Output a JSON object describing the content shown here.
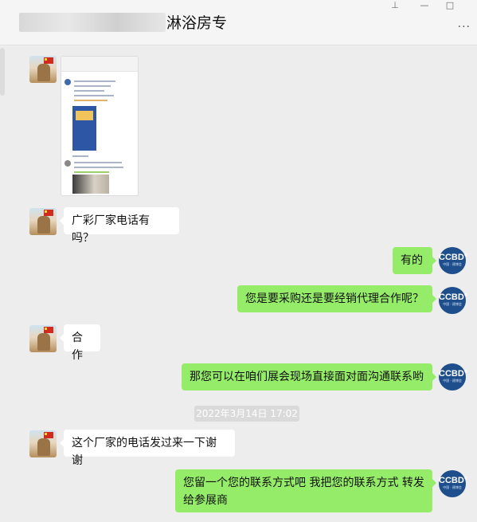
{
  "header": {
    "title": "淋浴房专"
  },
  "window_controls": {
    "pin": "⊥",
    "minimize": "—",
    "maximize": "□",
    "more": "···"
  },
  "ccbd_avatar": {
    "logo": "CCBD°",
    "sub": "中国 · 建博会"
  },
  "messages": [
    {
      "side": "left",
      "type": "image"
    },
    {
      "side": "left",
      "text": "广彩厂家电话有吗？"
    },
    {
      "side": "right",
      "text": "有的"
    },
    {
      "side": "right",
      "text": "您是要采购还是要经销代理合作呢？"
    },
    {
      "side": "left",
      "text": "合作"
    },
    {
      "side": "right",
      "text": "那您可以在咱们展会现场直接面对面沟通联系哟"
    },
    {
      "side": "left",
      "text": "这个厂家的电话发过来一下谢谢"
    },
    {
      "side": "right",
      "text": "您留一个您的联系方式吧 我把您的联系方式 转发给参展商"
    }
  ],
  "timestamp": "2022年3月14日 17:02"
}
